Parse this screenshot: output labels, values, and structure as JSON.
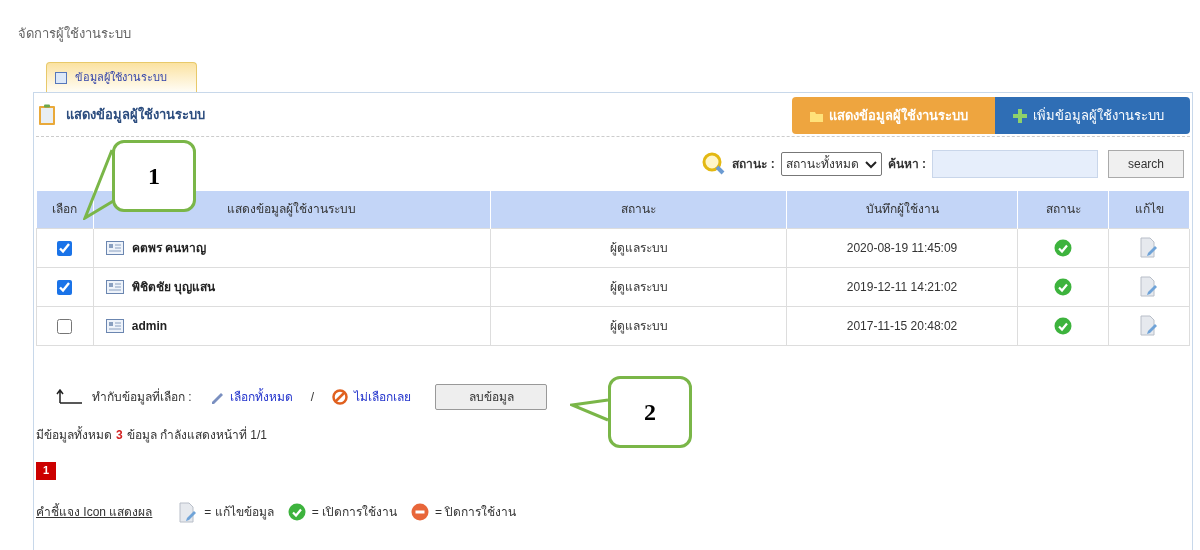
{
  "page_title": "จัดการผู้ใช้งานระบบ",
  "tabs": [
    {
      "label": "ข้อมูลผู้ใช้งานระบบ",
      "selected": true
    }
  ],
  "panel_title": "แสดงข้อมูลผู้ใช้งานระบบ",
  "header_buttons": [
    {
      "label": "แสดงข้อมูลผู้ใช้งานระบบ",
      "kind": "list",
      "selected": true
    },
    {
      "label": "เพิ่มข้อมูลผู้ใช้งานระบบ",
      "kind": "add",
      "selected": false
    }
  ],
  "filter": {
    "status_label": "สถานะ :",
    "status_value": "สถานะทั้งหมด",
    "search_label": "ค้นหา :",
    "search_button": "search"
  },
  "table": {
    "columns": [
      "เลือก",
      "แสดงข้อมูลผู้ใช้งานระบบ",
      "สถานะ",
      "บันทึกผู้ใช้งาน",
      "สถานะ",
      "แก้ไข"
    ],
    "rows": [
      {
        "checked": true,
        "name": "คตพร คนหาญ",
        "role": "ผู้ดูแลระบบ",
        "saved": "2020-08-19 11:45:09",
        "active": true
      },
      {
        "checked": true,
        "name": "พิชิตชัย บุญแสน",
        "role": "ผู้ดูแลระบบ",
        "saved": "2019-12-11 14:21:02",
        "active": true
      },
      {
        "checked": false,
        "name": "admin",
        "role": "ผู้ดูแลระบบ",
        "saved": "2017-11-15 20:48:02",
        "active": true
      }
    ]
  },
  "bulk": {
    "label": "ทำกับข้อมูลที่เลือก :",
    "select_all": "เลือกทั้งหมด",
    "separator": "/",
    "select_none": "ไม่เลือกเลย",
    "delete_button": "ลบข้อมูล"
  },
  "summary": {
    "prefix": "มีข้อมูลทั้งหมด",
    "count": "3",
    "suffix": "ข้อมูล กำลังแสดงหน้าที่ 1/1"
  },
  "pages": [
    {
      "label": "1",
      "selected": true
    }
  ],
  "legend": {
    "title": "คำชี้แจง Icon แสดงผล",
    "items": [
      {
        "kind": "edit",
        "label": "= แก้ไขข้อมูล"
      },
      {
        "kind": "on",
        "label": "= เปิดการใช้งาน"
      },
      {
        "kind": "off",
        "label": "= ปิดการใช้งาน"
      }
    ]
  },
  "callouts": [
    {
      "label": "1"
    },
    {
      "label": "2"
    }
  ]
}
